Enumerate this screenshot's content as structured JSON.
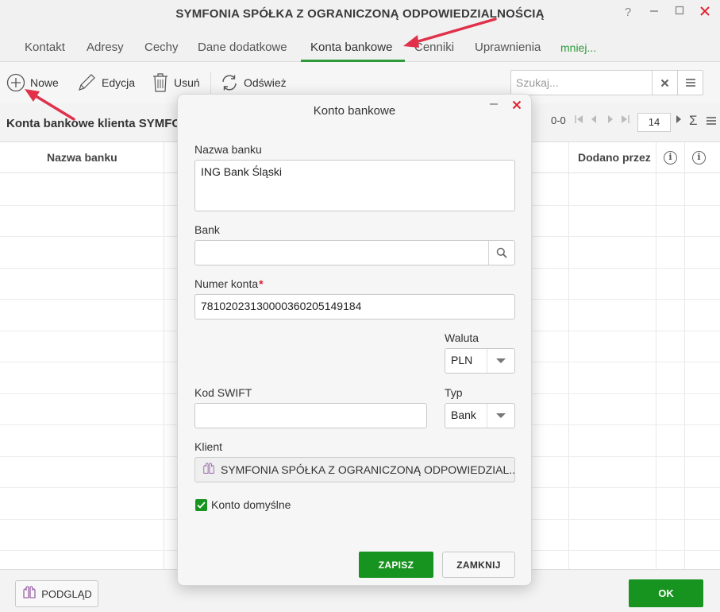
{
  "window": {
    "title": "SYMFONIA SPÓŁKA Z OGRANICZONĄ ODPOWIEDZIALNOŚCIĄ",
    "help": "?"
  },
  "tabs": [
    {
      "label": "Kontakt",
      "active": false
    },
    {
      "label": "Adresy",
      "active": false
    },
    {
      "label": "Cechy",
      "active": false
    },
    {
      "label": "Dane dodatkowe",
      "active": false
    },
    {
      "label": "Konta bankowe",
      "active": true
    },
    {
      "label": "Cenniki",
      "active": false
    },
    {
      "label": "Uprawnienia",
      "active": false
    }
  ],
  "tabs_more": "mniej...",
  "toolbar": {
    "new_label": "Nowe",
    "edit_label": "Edycja",
    "delete_label": "Usuń",
    "refresh_label": "Odśwież",
    "search_placeholder": "Szukaj..."
  },
  "list": {
    "title": "Konta bankowe klienta SYMFON",
    "range": "0-0",
    "page_size": "14",
    "columns": [
      "Nazwa banku",
      "Dodano przez"
    ]
  },
  "footer": {
    "preview_label": "PODGLĄD",
    "ok_label": "OK"
  },
  "dialog": {
    "title": "Konto bankowe",
    "bank_name_label": "Nazwa banku",
    "bank_name_value": "ING Bank Śląski",
    "bank_label": "Bank",
    "bank_value": "",
    "account_number_label": "Numer konta",
    "required_mark": "*",
    "account_number_value": "78102023130000360205149184",
    "currency_label": "Waluta",
    "currency_value": "PLN",
    "swift_label": "Kod SWIFT",
    "swift_value": "",
    "type_label": "Typ",
    "type_value": "Bank",
    "client_label": "Klient",
    "client_value": "SYMFONIA SPÓŁKA Z OGRANICZONĄ ODPOWIEDZIAL...",
    "default_account_label": "Konto domyślne",
    "default_account_checked": true,
    "save_label": "ZAPISZ",
    "close_label": "ZAMKNIJ"
  },
  "colors": {
    "accent_green": "#17931f",
    "close_red": "#e0202f",
    "annotation_arrow": "#e0304a"
  }
}
